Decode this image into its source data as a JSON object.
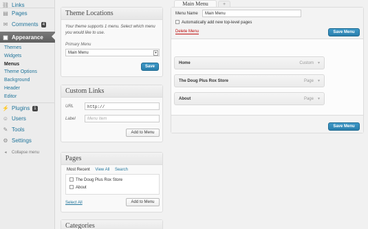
{
  "sidebar": {
    "links": "Links",
    "pages": "Pages",
    "comments": "Comments",
    "comments_count": "4",
    "appearance": "Appearance",
    "sub": [
      "Themes",
      "Widgets",
      "Menus",
      "Theme Options",
      "Background",
      "Header",
      "Editor"
    ],
    "plugins": "Plugins",
    "plugins_count": "1",
    "users": "Users",
    "tools": "Tools",
    "settings": "Settings",
    "collapse": "Collapse menu"
  },
  "theme_locations": {
    "title": "Theme Locations",
    "desc": "Your theme supports 1 menu. Select which menu you would like to use.",
    "primary_label": "Primary Menu",
    "primary_value": "Main Menu",
    "save": "Save"
  },
  "custom_links": {
    "title": "Custom Links",
    "url_label": "URL",
    "url_value": "http://",
    "label_label": "Label",
    "label_placeholder": "Menu Item",
    "add": "Add to Menu"
  },
  "pages_box": {
    "title": "Pages",
    "tabs": [
      "Most Recent",
      "View All",
      "Search"
    ],
    "items": [
      "The Doug Plus Rox Store",
      "About"
    ],
    "select_all": "Select All",
    "add": "Add to Menu"
  },
  "categories": {
    "title": "Categories"
  },
  "menu_editor": {
    "tab": "Main Menu",
    "add_tab": "+",
    "name_label": "Menu Name",
    "name_value": "Main Menu",
    "auto_add": "Automatically add new top-level pages",
    "delete": "Delete Menu",
    "save": "Save Menu",
    "items": [
      {
        "title": "Home",
        "type": "Custom"
      },
      {
        "title": "The Doug Plus Rox Store",
        "type": "Page"
      },
      {
        "title": "About",
        "type": "Page"
      }
    ]
  }
}
